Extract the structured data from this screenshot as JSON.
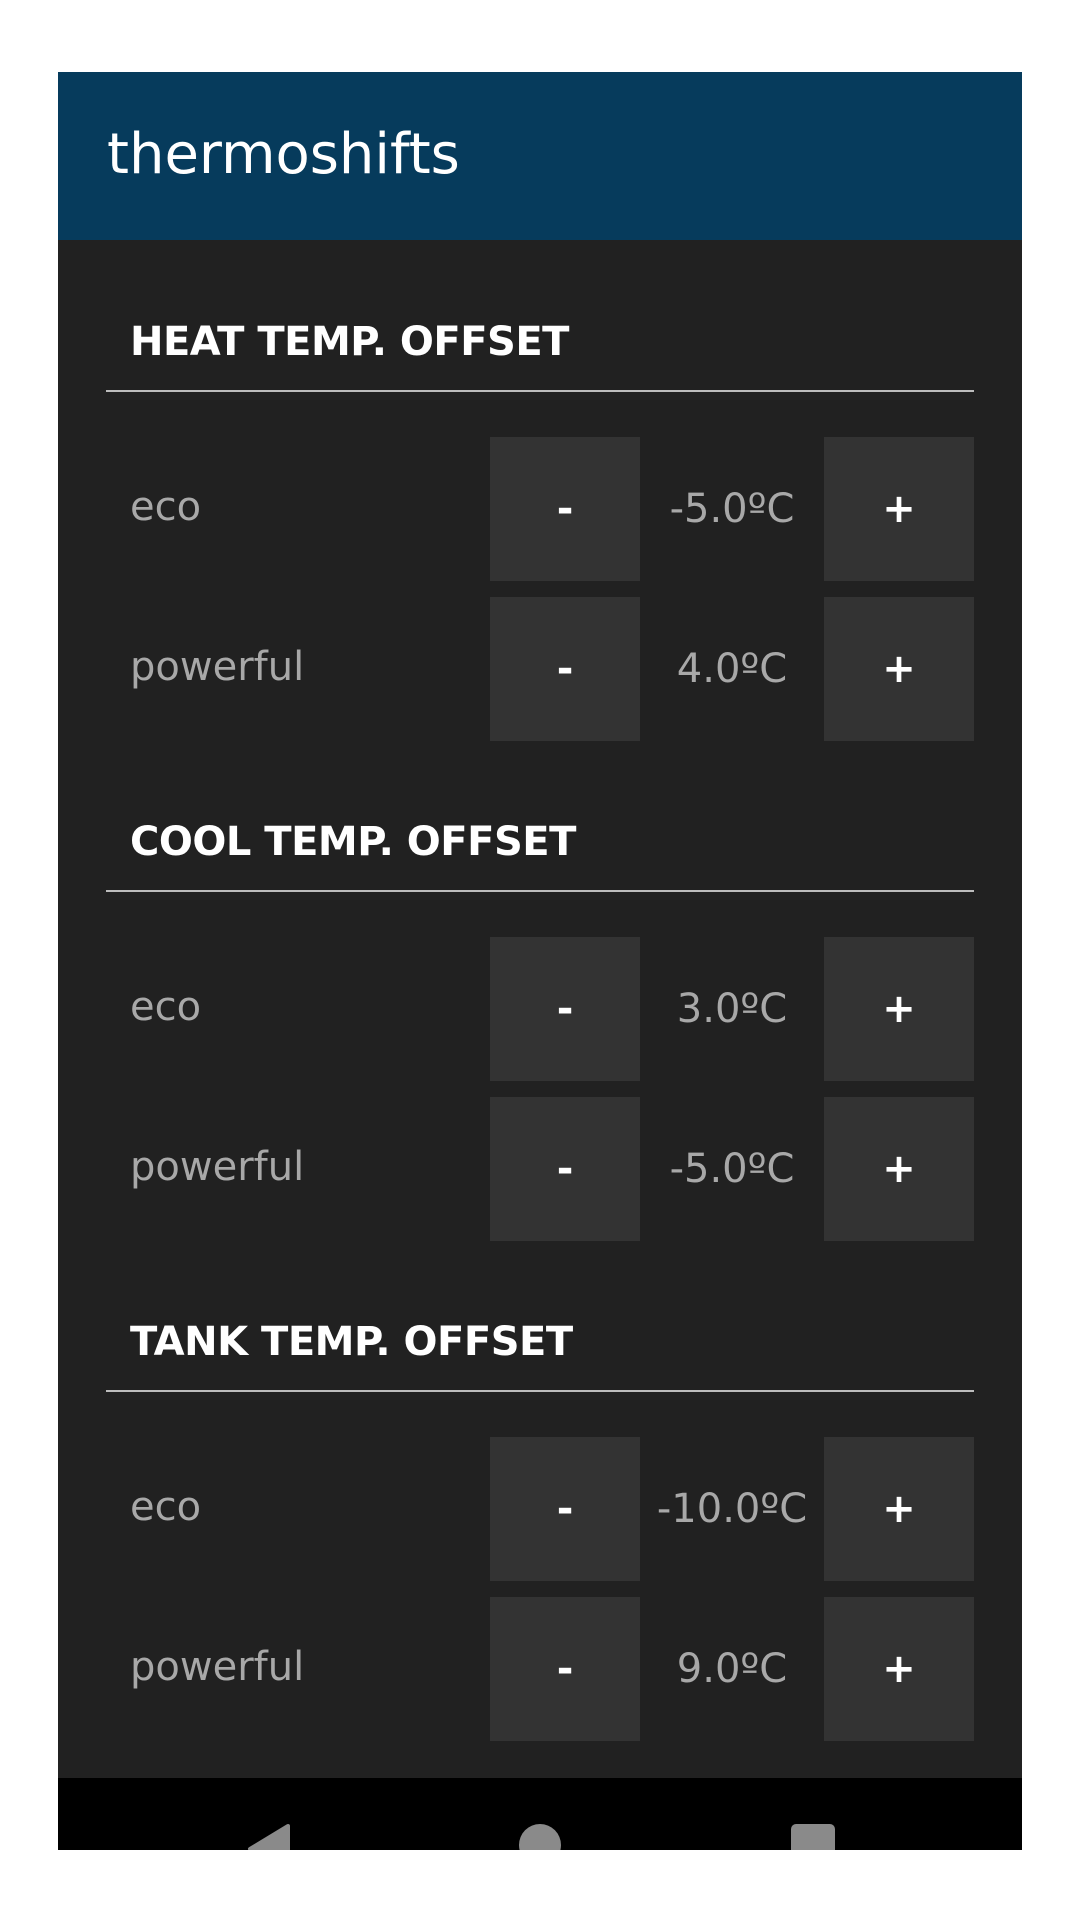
{
  "app_bar": {
    "title": "thermoshifts",
    "color": "#063b5c"
  },
  "theme": {
    "background": "#212121",
    "button_background": "#333333",
    "divider": "#bdbdbd"
  },
  "sections": [
    {
      "title": "HEAT TEMP. OFFSET",
      "rows": [
        {
          "label": "eco",
          "minus": "-",
          "value": "-5.0ºC",
          "plus": "+"
        },
        {
          "label": "powerful",
          "minus": "-",
          "value": "4.0ºC",
          "plus": "+"
        }
      ]
    },
    {
      "title": "COOL TEMP. OFFSET",
      "rows": [
        {
          "label": "eco",
          "minus": "-",
          "value": "3.0ºC",
          "plus": "+"
        },
        {
          "label": "powerful",
          "minus": "-",
          "value": "-5.0ºC",
          "plus": "+"
        }
      ]
    },
    {
      "title": "TANK TEMP. OFFSET",
      "rows": [
        {
          "label": "eco",
          "minus": "-",
          "value": "-10.0ºC",
          "plus": "+"
        },
        {
          "label": "powerful",
          "minus": "-",
          "value": "9.0ºC",
          "plus": "+"
        }
      ]
    }
  ],
  "nav_bar": {
    "icons": [
      "back-icon",
      "home-icon",
      "recents-icon"
    ]
  }
}
